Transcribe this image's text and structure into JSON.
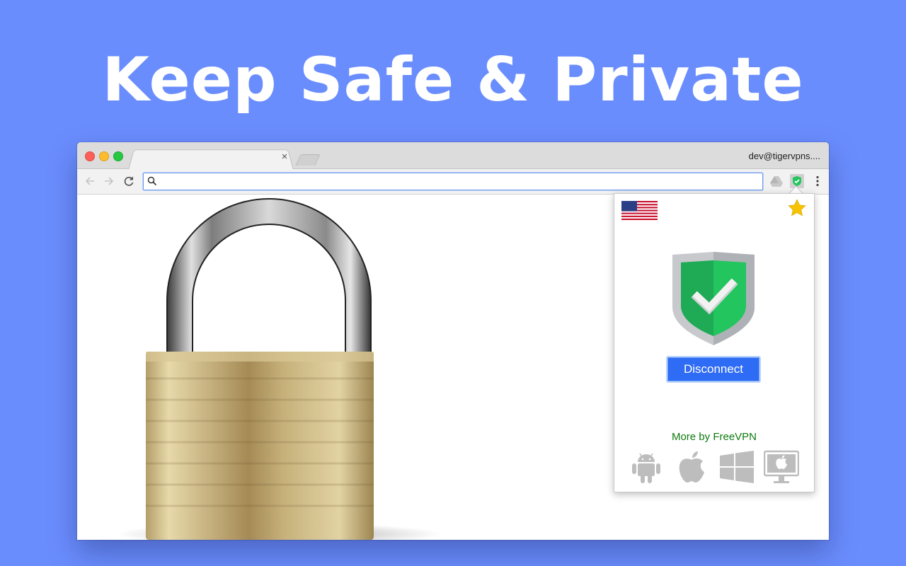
{
  "headline": "Keep Safe & Private",
  "browser": {
    "profile_name": "dev@tigervpns....",
    "tab_close": "×",
    "address_value": "",
    "address_placeholder": ""
  },
  "popup": {
    "country": "United States",
    "disconnect_label": "Disconnect",
    "more_label": "More by FreeVPN",
    "platforms": [
      "android-icon",
      "apple-icon",
      "windows-icon",
      "mac-desktop-icon"
    ]
  },
  "colors": {
    "background": "#6a8dfd",
    "button": "#2f6cf5",
    "shield_green": "#22c55e",
    "more_text": "#0e7a0e",
    "star": "#f5c300"
  }
}
